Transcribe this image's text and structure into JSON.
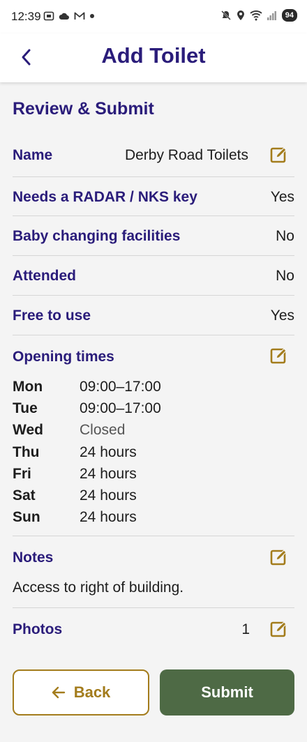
{
  "status_bar": {
    "time": "12:39",
    "battery": "94",
    "left_icons": [
      "screenshot-icon",
      "cloud-icon",
      "gmail-icon",
      "dot-icon"
    ],
    "right_icons": [
      "mute-icon",
      "location-icon",
      "wifi-icon",
      "signal-icon",
      "battery-icon"
    ]
  },
  "header": {
    "title": "Add Toilet",
    "back_icon": "chevron-left-icon"
  },
  "review": {
    "title": "Review & Submit",
    "name_label": "Name",
    "name_value": "Derby Road Toilets",
    "radar_label": "Needs a RADAR / NKS key",
    "radar_value": "Yes",
    "baby_label": "Baby changing facilities",
    "baby_value": "No",
    "attended_label": "Attended",
    "attended_value": "No",
    "free_label": "Free to use",
    "free_value": "Yes",
    "opening_label": "Opening times",
    "hours": [
      {
        "day": "Mon",
        "time": "09:00–17:00"
      },
      {
        "day": "Tue",
        "time": "09:00–17:00"
      },
      {
        "day": "Wed",
        "time": "Closed"
      },
      {
        "day": "Thu",
        "time": "24 hours"
      },
      {
        "day": "Fri",
        "time": "24 hours"
      },
      {
        "day": "Sat",
        "time": "24 hours"
      },
      {
        "day": "Sun",
        "time": "24 hours"
      }
    ],
    "notes_label": "Notes",
    "notes_value": "Access to right of building.",
    "photos_label": "Photos",
    "photos_value": "1"
  },
  "actions": {
    "back_label": "Back",
    "submit_label": "Submit"
  },
  "colors": {
    "primary": "#2a1c7a",
    "accent_gold": "#a37c1c",
    "submit_green": "#4e6a45",
    "background": "#f4f4f4"
  }
}
